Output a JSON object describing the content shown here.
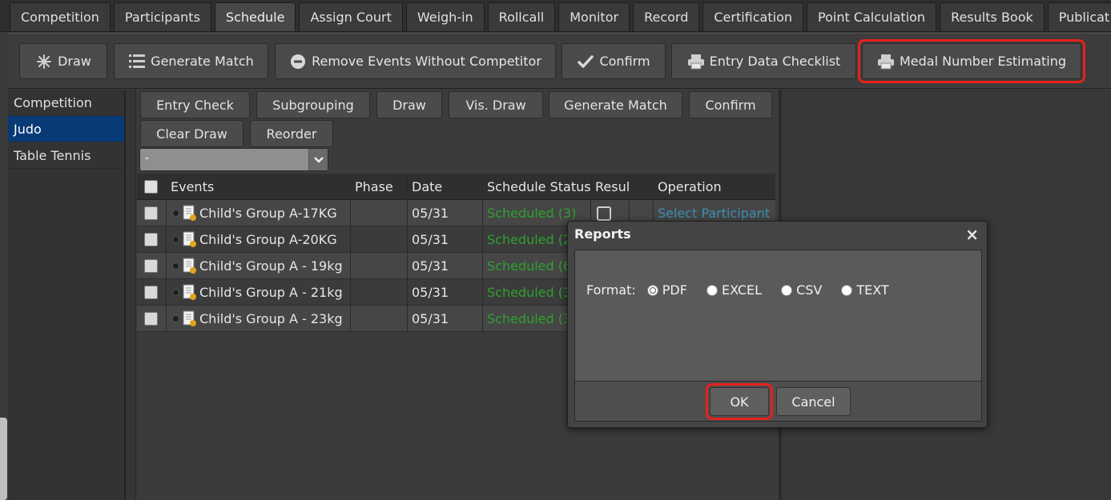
{
  "top_tabs": [
    {
      "label": "Competition",
      "active": false
    },
    {
      "label": "Participants",
      "active": false
    },
    {
      "label": "Schedule",
      "active": true
    },
    {
      "label": "Assign Court",
      "active": false
    },
    {
      "label": "Weigh-in",
      "active": false
    },
    {
      "label": "Rollcall",
      "active": false
    },
    {
      "label": "Monitor",
      "active": false
    },
    {
      "label": "Record",
      "active": false
    },
    {
      "label": "Certification",
      "active": false
    },
    {
      "label": "Point Calculation",
      "active": false
    },
    {
      "label": "Results Book",
      "active": false
    },
    {
      "label": "Publicat",
      "active": false
    }
  ],
  "toolbar": {
    "draw": {
      "label": "Draw",
      "icon": "sparkle-icon"
    },
    "generate_match": {
      "label": "Generate Match",
      "icon": "list-icon"
    },
    "remove_events": {
      "label": "Remove Events Without Competitor",
      "icon": "minus-circle-icon"
    },
    "confirm": {
      "label": "Confirm",
      "icon": "checkmark-icon"
    },
    "entry_checklist": {
      "label": "Entry Data Checklist",
      "icon": "printer-icon"
    },
    "medal_estimating": {
      "label": "Medal Number Estimating",
      "icon": "printer-icon"
    }
  },
  "sidebar": {
    "items": [
      {
        "label": "Competition",
        "active": false
      },
      {
        "label": "Judo",
        "active": true
      },
      {
        "label": "Table Tennis",
        "active": false
      }
    ]
  },
  "subtoolbar": {
    "entry_check": "Entry Check",
    "subgrouping": "Subgrouping",
    "draw": "Draw",
    "vis_draw": "Vis. Draw",
    "generate_match": "Generate Match",
    "confirm": "Confirm",
    "clear_draw": "Clear Draw",
    "reorder": "Reorder"
  },
  "filter_select": {
    "value": "-"
  },
  "grid": {
    "headers": {
      "events": "Events",
      "phase": "Phase",
      "date": "Date",
      "status": "Schedule Status",
      "result": "Resul",
      "operation": "Operation"
    },
    "rows": [
      {
        "event": "Child's Group A-17KG",
        "phase": "",
        "date": "05/31",
        "status": "Scheduled (3)",
        "operation": "Select Participant"
      },
      {
        "event": "Child's Group A-20KG",
        "phase": "",
        "date": "05/31",
        "status": "Scheduled (2",
        "operation": ""
      },
      {
        "event": "Child's Group A - 19kg",
        "phase": "",
        "date": "05/31",
        "status": "Scheduled (6",
        "operation": ""
      },
      {
        "event": "Child's Group A - 21kg",
        "phase": "",
        "date": "05/31",
        "status": "Scheduled (3",
        "operation": ""
      },
      {
        "event": "Child's Group A - 23kg",
        "phase": "",
        "date": "05/31",
        "status": "Scheduled (3",
        "operation": ""
      }
    ]
  },
  "dialog": {
    "title": "Reports",
    "close": "×",
    "format_label": "Format:",
    "options": [
      "PDF",
      "EXCEL",
      "CSV",
      "TEXT"
    ],
    "selected": "PDF",
    "ok": "OK",
    "cancel": "Cancel"
  },
  "colors": {
    "accent_active_sidebar": "#083a76",
    "status_green": "#2fa12f",
    "link_blue": "#3a8fb5",
    "highlight_red": "#e8201d"
  }
}
